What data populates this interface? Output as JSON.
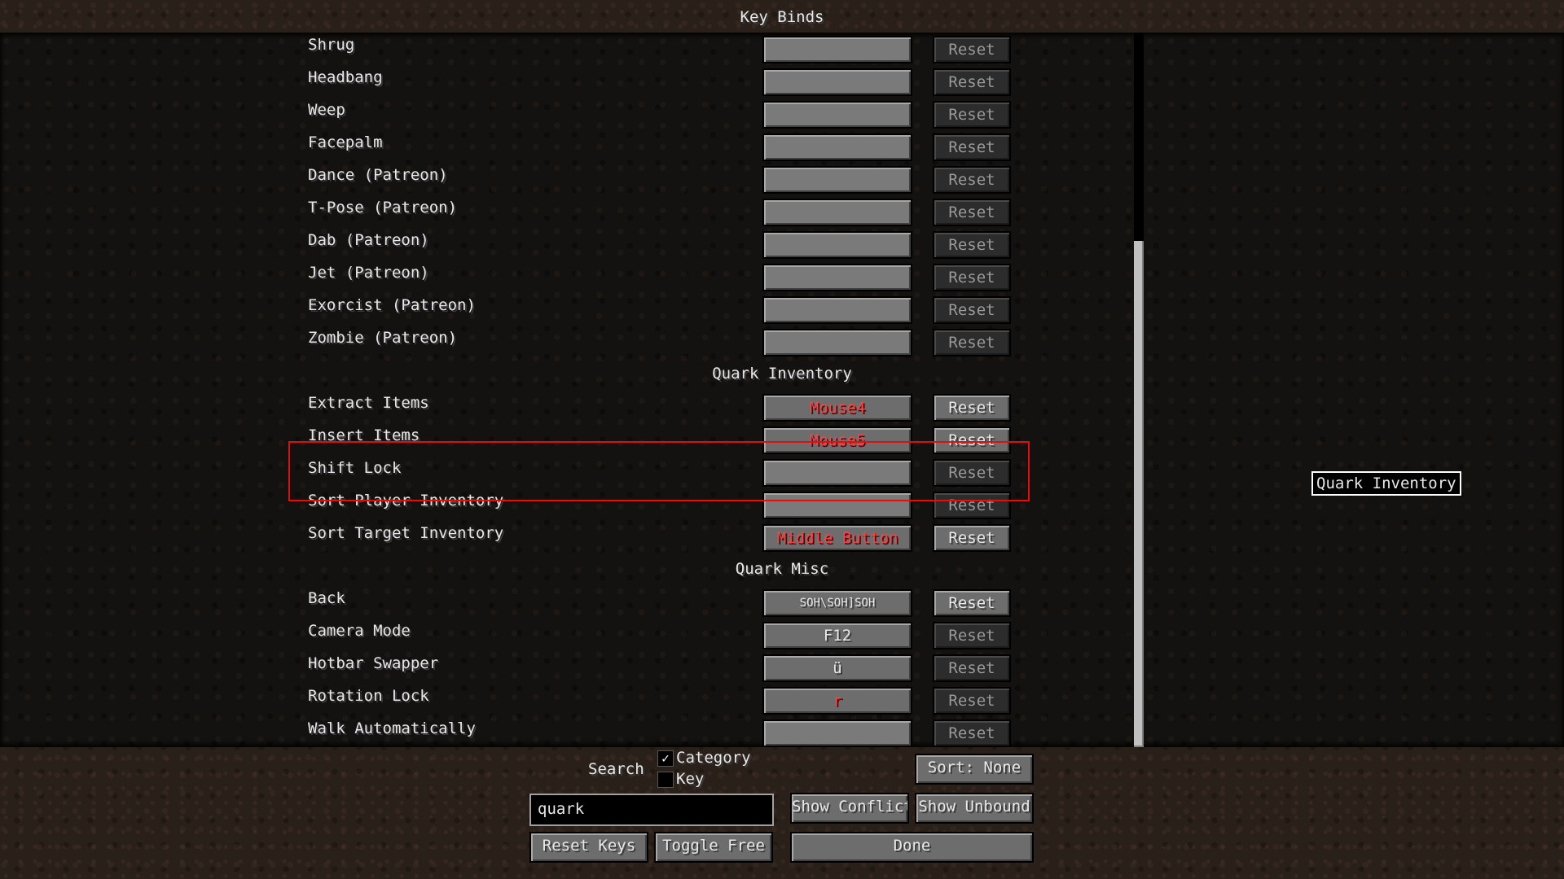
{
  "window": {
    "title": "Key Binds"
  },
  "rows_top": [
    {
      "label": "Shrug",
      "key": "",
      "reset": "Reset"
    },
    {
      "label": "Headbang",
      "key": "",
      "reset": "Reset"
    },
    {
      "label": "Weep",
      "key": "",
      "reset": "Reset"
    },
    {
      "label": "Facepalm",
      "key": "",
      "reset": "Reset"
    },
    {
      "label": "Dance (Patreon)",
      "key": "",
      "reset": "Reset"
    },
    {
      "label": "T-Pose (Patreon)",
      "key": "",
      "reset": "Reset"
    },
    {
      "label": "Dab (Patreon)",
      "key": "",
      "reset": "Reset"
    },
    {
      "label": "Jet (Patreon)",
      "key": "",
      "reset": "Reset"
    },
    {
      "label": "Exorcist (Patreon)",
      "key": "",
      "reset": "Reset"
    },
    {
      "label": "Zombie (Patreon)",
      "key": "",
      "reset": "Reset"
    }
  ],
  "category_inventory": "Quark Inventory",
  "rows_inventory": [
    {
      "label": "Extract Items",
      "key": "Mouse4",
      "reset": "Reset"
    },
    {
      "label": "Insert Items",
      "key": "Mouse5",
      "reset": "Reset"
    },
    {
      "label": "Shift Lock",
      "key": "",
      "reset": "Reset"
    },
    {
      "label": "Sort Player Inventory",
      "key": "",
      "reset": "Reset"
    },
    {
      "label": "Sort Target Inventory",
      "key": "Middle Button",
      "reset": "Reset"
    }
  ],
  "category_misc": "Quark Misc",
  "rows_misc": [
    {
      "label": "Back",
      "key": "SOH\\SOH]SOH",
      "reset": "Reset"
    },
    {
      "label": "Camera Mode",
      "key": "F12",
      "reset": "Reset"
    },
    {
      "label": "Hotbar Swapper",
      "key": "ü",
      "reset": "Reset"
    },
    {
      "label": "Rotation Lock",
      "key": "r",
      "reset": "Reset"
    },
    {
      "label": "Walk Automatically",
      "key": "",
      "reset": "Reset"
    }
  ],
  "tooltip": "Quark Inventory",
  "footer": {
    "search_label": "Search",
    "category_label": "Category",
    "key_label": "Key",
    "category_checked": "✓",
    "sort_button": "Sort: None",
    "search_value": "quark",
    "show_conflicts": "Show Conflicts",
    "show_unbound": "Show Unbound",
    "reset_keys": "Reset Keys",
    "toggle_free": "Toggle Free",
    "done": "Done"
  },
  "colors": {
    "conflict": "#ff4040",
    "highlight": "#e01010"
  }
}
